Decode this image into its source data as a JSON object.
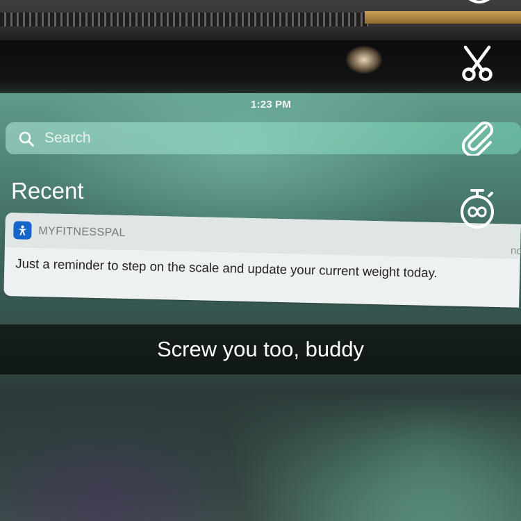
{
  "status_bar": {
    "time": "1:23 PM"
  },
  "search": {
    "placeholder": "Search"
  },
  "section": {
    "title": "Recent"
  },
  "notification": {
    "app_name": "MYFITNESSPAL",
    "time": "now",
    "message": "Just a reminder to step on the scale and update your current weight today.",
    "app_icon": "myfitnesspal-icon",
    "icon_color": "#1566c8"
  },
  "caption": {
    "text": "Screw you too, buddy"
  },
  "tools": {
    "icons": [
      "pencil-icon",
      "scissors-icon",
      "paperclip-icon",
      "timer-icon"
    ]
  },
  "colors": {
    "screen_tint": "#5f9b8c",
    "caption_bar": "#000000"
  }
}
